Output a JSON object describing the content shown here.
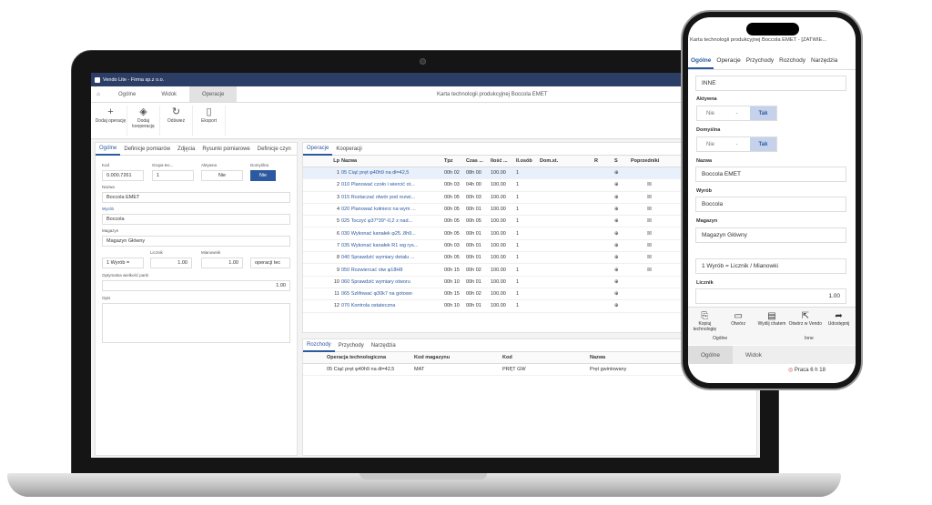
{
  "app": {
    "window_title": "Vendo Lite - Firma sp.z o.o.",
    "doc_title": "Karta technologii produkcyjnej Boccola EMET",
    "tabs": [
      "Ogólne",
      "Widok",
      "Operacje"
    ]
  },
  "ribbon": [
    "Dodaj operację",
    "Dodaj kooperację",
    "Odśwież",
    "Eksport"
  ],
  "left": {
    "tabs": [
      "Ogólne",
      "Definicje pomiarów",
      "Zdjęcia",
      "Rysunki pomiarowe",
      "Definicje czyn"
    ],
    "kod_label": "Kod",
    "kod": "0.000.7261",
    "grupa_label": "Grupa tec...",
    "grupa": "1",
    "aktywna_label": "Aktywna",
    "aktywna": "Nie",
    "domyslna_label": "Domyślna",
    "domyslna": "Nie",
    "nazwa_label": "Nazwa",
    "nazwa": "Boccola EMET",
    "wyrob_label": "Wyrób",
    "wyrob": "Boccola",
    "magazyn_label": "Magazyn",
    "magazyn": "Magazyn Główny",
    "licznik_label": "Licznik",
    "mianownik_label": "Mianownik",
    "wyrob_eq": "1 Wyrób =",
    "licznik": "1.00",
    "mianownik": "1.00",
    "op_btn": "operacji tec",
    "opt_label": "Optymalna wielkość partii",
    "opt": "1.00",
    "opis_label": "Opis"
  },
  "ops": {
    "tabs": [
      "Operacje",
      "Kooperacji"
    ],
    "headers": [
      "Lp",
      "Nazwa",
      "Tpz",
      "Czas ...",
      "Ilość ...",
      "Il.osób",
      "Dom.st.",
      "R",
      "S",
      "Poprzedniki"
    ],
    "rows": [
      [
        "1",
        "05 Ciąć pręt φ40h9 na dł=42,5",
        "00h 02",
        "08h 00",
        "100.00",
        "1"
      ],
      [
        "2",
        "010 Planować czoło i wiercić ot...",
        "00h 03",
        "04h 00",
        "100.00",
        "1"
      ],
      [
        "3",
        "015 Roztaczać otwór pod rozwi...",
        "00h 05",
        "00h 03",
        "100.00",
        "1"
      ],
      [
        "4",
        "020 Planować kołnierz na wym ...",
        "00h 05",
        "00h 01",
        "100.00",
        "1"
      ],
      [
        "5",
        "025 Toczyć φ37*39°-0,2 z nad...",
        "00h 05",
        "00h 05",
        "100.00",
        "1"
      ],
      [
        "6",
        "030 Wykonać kanałek φ25..8h9...",
        "00h 05",
        "00h 01",
        "100.00",
        "1"
      ],
      [
        "7",
        "035 Wykonać kanałek R1 wg rys...",
        "00h 03",
        "00h 01",
        "100.00",
        "1"
      ],
      [
        "8",
        "040 Sprawdzić wymiary detalu ...",
        "00h 05",
        "00h 01",
        "100.00",
        "1"
      ],
      [
        "9",
        "050 Rozwiercać otw φ18H8",
        "00h 15",
        "00h 02",
        "100.00",
        "1"
      ],
      [
        "10",
        "060 Sprawdzić wymiary otworu",
        "00h 10",
        "00h 01",
        "100.00",
        "1"
      ],
      [
        "11",
        "065 Szlifować φ30k7 na gotowo",
        "00h 15",
        "00h 02",
        "100.00",
        "1"
      ],
      [
        "12",
        "070 Kontrola ostateczna",
        "00h 10",
        "00h 01",
        "100.00",
        "1"
      ]
    ]
  },
  "bottom": {
    "tabs": [
      "Rozchody",
      "Przychody",
      "Narzędzia"
    ],
    "headers": [
      "Operacja technologiczna",
      "Kod magazynu",
      "Kod",
      "Nazwa"
    ],
    "row": [
      "05 Ciąć pręt φ40h9 na dł=42,5",
      "MAT",
      "PRĘT GW",
      "Pręt gwintowany"
    ]
  },
  "phone": {
    "title": "Karta technologii produkcyjnej Boccola EMET - [ZATWIE...",
    "tabs": [
      "Ogólne",
      "Operacje",
      "Przychody",
      "Rozchody",
      "Narzędzia"
    ],
    "inne": "INNE",
    "aktywna_label": "Aktywna",
    "domyslna_label": "Domyślna",
    "nie": "Nie",
    "dash": "-",
    "tak": "Tak",
    "nazwa_label": "Nazwa",
    "nazwa": "Boccola EMET",
    "wyrob_label": "Wyrób",
    "wyrob": "Boccola",
    "magazyn_label": "Magazyn",
    "magazyn": "Magazyn Główny",
    "formula": "1 Wyrób = Licznik / Mianowki",
    "licznik_label": "Licznik",
    "licznik": "1.00",
    "bar": [
      "Kopiuj technologię",
      "Otwórz",
      "Wyślij chatem",
      "Otwórz w Vendo",
      "Udostępnij"
    ],
    "group_left": "Ogólne",
    "group_right": "Inne",
    "bottom_tabs": [
      "Ogólne",
      "Widok"
    ],
    "status": "Praca 6 h 18"
  }
}
